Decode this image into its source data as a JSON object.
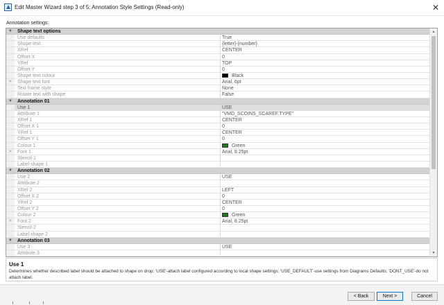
{
  "window": {
    "title": "Edit Master Wizard step 3 of 5: Annotation Style Settings (Read-only)",
    "close_glyph": "✕"
  },
  "settings_label": "Annotation settings:",
  "categories": [
    {
      "name": "Shape text options",
      "rows": [
        {
          "name": "Use defaults",
          "value": "True"
        },
        {
          "name": "Shape text",
          "value": "{letter}-{number}"
        },
        {
          "name": "XRef",
          "value": "CENTER"
        },
        {
          "name": "Offset X",
          "value": "0"
        },
        {
          "name": "YRef",
          "value": "TOP"
        },
        {
          "name": "Offset Y",
          "value": "0"
        },
        {
          "name": "Shape text colour",
          "value": "Black",
          "swatch": "#000000"
        },
        {
          "name": "Shape text font",
          "value": "Arial, 6pt",
          "expand": true
        },
        {
          "name": "Text frame style",
          "value": "None"
        },
        {
          "name": "Rotate text with shape",
          "value": "False"
        }
      ]
    },
    {
      "name": "Annotation 01",
      "rows": [
        {
          "name": "Use  1",
          "value": "USE",
          "selected": true
        },
        {
          "name": "Attribute  1",
          "value": "\"VMD_SCOINS_SCAREF.TYPE\""
        },
        {
          "name": "XRef  1",
          "value": "CENTER"
        },
        {
          "name": "Offset X  1",
          "value": "0"
        },
        {
          "name": "YRef  1",
          "value": "CENTER"
        },
        {
          "name": "Offset Y  1",
          "value": "0"
        },
        {
          "name": "Colour  1",
          "value": "Green",
          "swatch": "#1e7a1e"
        },
        {
          "name": "Font  1",
          "value": "Arial, 8.25pt",
          "expand": true
        },
        {
          "name": "Stencil  1",
          "value": ""
        },
        {
          "name": "Label shape  1",
          "value": ""
        }
      ]
    },
    {
      "name": "Annotation 02",
      "rows": [
        {
          "name": "Use  2",
          "value": "USE"
        },
        {
          "name": "Attribute  2",
          "value": ""
        },
        {
          "name": "XRef  2",
          "value": "LEFT"
        },
        {
          "name": "Offset X  2",
          "value": "0"
        },
        {
          "name": "YRef  2",
          "value": "CENTER"
        },
        {
          "name": "Offset Y  2",
          "value": "0"
        },
        {
          "name": "Colour  2",
          "value": "Green",
          "swatch": "#1e7a1e"
        },
        {
          "name": "Font  2",
          "value": "Arial, 8.25pt",
          "expand": true
        },
        {
          "name": "Stencil  2",
          "value": ""
        },
        {
          "name": "Label shape  2",
          "value": ""
        }
      ]
    },
    {
      "name": "Annotation 03",
      "rows": [
        {
          "name": "Use  3",
          "value": "USE"
        },
        {
          "name": "Attribute  3",
          "value": ""
        }
      ]
    }
  ],
  "description": {
    "title": "Use   1",
    "text": "Determines whether described label should be attached to shape on drop: 'USE'-attach label configured according to local shape settings; 'USE_DEFAULT'-use settings from Diagrams Defaults; 'DONT_USE'-do not attach label."
  },
  "buttons": {
    "back": "< Back",
    "next": "Next >",
    "cancel": "Cancel"
  }
}
